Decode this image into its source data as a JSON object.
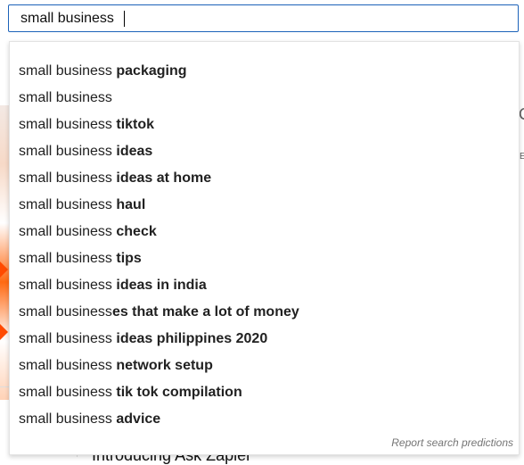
{
  "search": {
    "value": "small business",
    "placeholder": ""
  },
  "suggestions": [
    {
      "typed": "small business",
      "rest": " packaging"
    },
    {
      "typed": "small business",
      "rest": ""
    },
    {
      "typed": "small business",
      "rest": " tiktok"
    },
    {
      "typed": "small business",
      "rest": " ideas"
    },
    {
      "typed": "small business",
      "rest": " ideas at home"
    },
    {
      "typed": "small business",
      "rest": " haul"
    },
    {
      "typed": "small business",
      "rest": " check"
    },
    {
      "typed": "small business",
      "rest": " tips"
    },
    {
      "typed": "small business",
      "rest": " ideas in india"
    },
    {
      "typed": "small business",
      "rest": "es that make a lot of money"
    },
    {
      "typed": "small business",
      "rest": " ideas philippines 2020"
    },
    {
      "typed": "small business",
      "rest": " network setup"
    },
    {
      "typed": "small business",
      "rest": " tik tok compilation"
    },
    {
      "typed": "small business",
      "rest": " advice"
    }
  ],
  "report_label": "Report search predictions",
  "background": {
    "right_letter": "C",
    "right_small": "E",
    "bottom_title": "Introducing Ask Zapier"
  },
  "colors": {
    "focus_border": "#1c62b9",
    "accent_orange": "#ff4a00"
  }
}
